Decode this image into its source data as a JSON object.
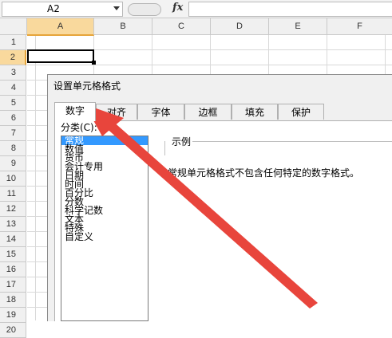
{
  "formula_bar": {
    "name_box": "A2",
    "fx_label": "fx",
    "formula": ""
  },
  "sheet": {
    "columns": [
      "A",
      "B",
      "C",
      "D",
      "E",
      "F"
    ],
    "rows": [
      "1",
      "2",
      "3",
      "4",
      "5",
      "6",
      "7",
      "8",
      "9",
      "10",
      "11",
      "12",
      "13",
      "14",
      "15",
      "16",
      "17",
      "18",
      "19",
      "20"
    ],
    "selected_column": "A",
    "selected_row": "2"
  },
  "dialog": {
    "title": "设置单元格格式",
    "tabs": [
      "数字",
      "对齐",
      "字体",
      "边框",
      "填充",
      "保护"
    ],
    "active_tab": "数字",
    "category_label": "分类(C):",
    "categories": [
      "常规",
      "数值",
      "货币",
      "会计专用",
      "日期",
      "时间",
      "百分比",
      "分数",
      "科学记数",
      "文本",
      "特殊",
      "自定义"
    ],
    "selected_category": "常规",
    "sample_label": "示例",
    "description": "常规单元格格式不包含任何特定的数字格式。"
  },
  "annotation": {
    "arrow_color": "#e8453c"
  }
}
